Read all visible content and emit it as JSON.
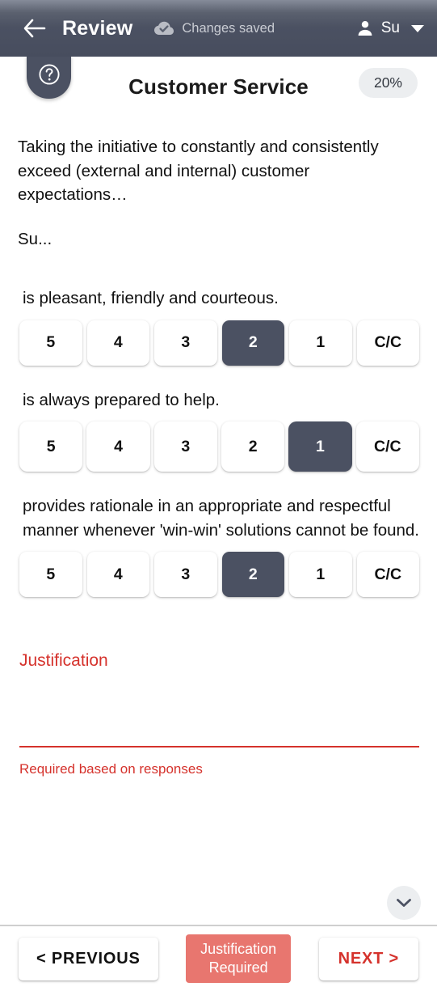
{
  "appbar": {
    "back_icon": "arrow-left-icon",
    "title": "Review",
    "save_status_icon": "cloud-check-icon",
    "save_status": "Changes saved",
    "user_icon": "person-icon",
    "user_name": "Su",
    "caret_icon": "caret-down-icon"
  },
  "help_tab": {
    "icon": "help-circle-icon"
  },
  "section": {
    "title": "Customer Service",
    "progress_badge": "20%",
    "description_line1": "Taking the initiative to constantly and consistently exceed (external and internal) customer expectations…",
    "description_line2": "Su..."
  },
  "questions": [
    {
      "text": "is pleasant, friendly and courteous.",
      "options": [
        "5",
        "4",
        "3",
        "2",
        "1",
        "C/C"
      ],
      "selected": "2"
    },
    {
      "text": "is always prepared to help.",
      "options": [
        "5",
        "4",
        "3",
        "2",
        "1",
        "C/C"
      ],
      "selected": "1"
    },
    {
      "text": "provides rationale in an appropriate and respectful manner whenever 'win-win' solutions cannot be found.",
      "options": [
        "5",
        "4",
        "3",
        "2",
        "1",
        "C/C"
      ],
      "selected": "2"
    }
  ],
  "justification": {
    "label": "Justification",
    "value": "",
    "placeholder": "",
    "hint": "Required based on responses"
  },
  "scroll_fab": {
    "icon": "chevron-down-icon"
  },
  "bottom_bar": {
    "previous_label": "<  PREVIOUS",
    "justification_required_label": "Justification Required",
    "next_label": "NEXT  >"
  },
  "colors": {
    "appbar": "#4b5162",
    "selected": "#4b5162",
    "error": "#d5322c",
    "chip": "#e8766f",
    "badge_bg": "#eceef0"
  }
}
